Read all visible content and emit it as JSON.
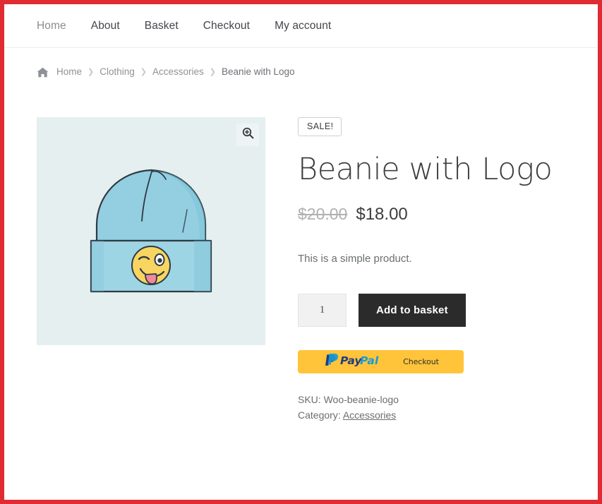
{
  "nav": {
    "items": [
      {
        "label": "Home",
        "current": true
      },
      {
        "label": "About",
        "current": false
      },
      {
        "label": "Basket",
        "current": false
      },
      {
        "label": "Checkout",
        "current": false
      },
      {
        "label": "My account",
        "current": false
      }
    ]
  },
  "breadcrumb": {
    "home_icon": "home-icon",
    "separator": "❯",
    "items": [
      {
        "label": "Home"
      },
      {
        "label": "Clothing"
      },
      {
        "label": "Accessories"
      },
      {
        "label": "Beanie with Logo"
      }
    ]
  },
  "gallery": {
    "zoom_icon": "magnifier-plus-icon",
    "image_alt": "Blue beanie hat with winking tongue-out emoji logo",
    "background_color": "#e5eff0"
  },
  "product": {
    "sale_badge": "SALE!",
    "title": "Beanie with Logo",
    "price_old": "$20.00",
    "price_new": "$18.00",
    "short_description": "This is a simple product.",
    "quantity_value": "1",
    "quantity_placeholder": "1",
    "add_to_basket_label": "Add to basket",
    "paypal": {
      "brand_pay": "Pay",
      "brand_pal": "Pal",
      "checkout_label": "Checkout",
      "background_color": "#ffc439"
    },
    "sku_label": "SKU:",
    "sku_value": "Woo-beanie-logo",
    "category_label": "Category:",
    "category_value": "Accessories"
  },
  "theme": {
    "border_color": "#e02b33",
    "button_color": "#2b2b2b"
  }
}
